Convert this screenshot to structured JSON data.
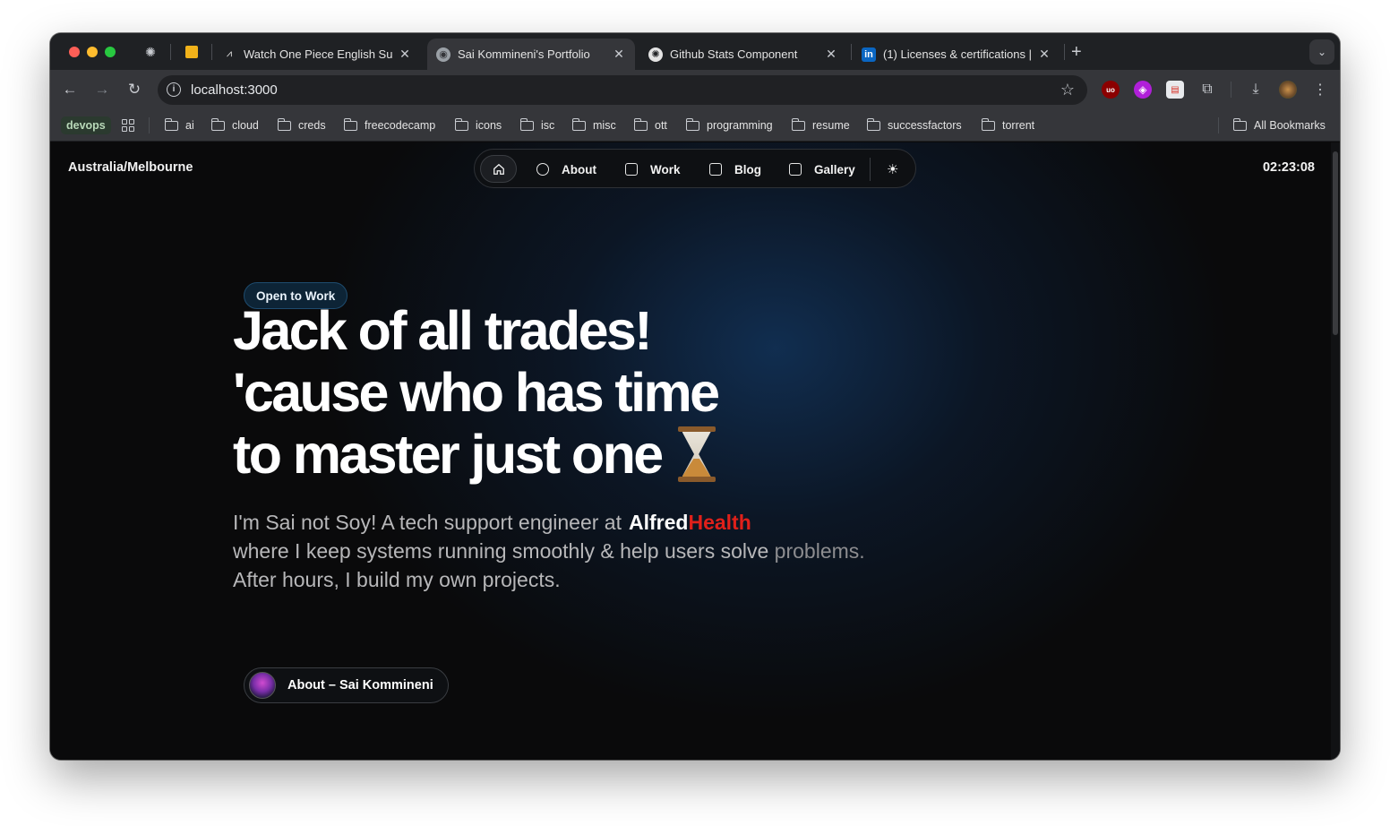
{
  "browser": {
    "tabs": [
      {
        "title": "Watch One Piece English Sub",
        "favicon": "anime-site-icon",
        "active": false
      },
      {
        "title": "Sai Kommineni's Portfolio",
        "favicon": "globe-icon",
        "active": true
      },
      {
        "title": "Github Stats Component",
        "favicon": "openai-icon",
        "active": false
      },
      {
        "title": "(1) Licenses & certifications |",
        "favicon": "linkedin-icon",
        "active": false
      }
    ],
    "url": "localhost:3000",
    "linkedin_glyph": "in",
    "ublock_glyph": "uo",
    "bookmarks": {
      "devops_label": "devops",
      "folders": [
        "ai",
        "cloud",
        "creds",
        "freecodecamp",
        "icons",
        "isc",
        "misc",
        "ott",
        "programming",
        "resume",
        "successfactors",
        "torrent"
      ],
      "all_label": "All Bookmarks"
    }
  },
  "site": {
    "timezone": "Australia/Melbourne",
    "clock": "02:23:08",
    "nav": {
      "about": "About",
      "work": "Work",
      "blog": "Blog",
      "gallery": "Gallery"
    },
    "badge": "Open to Work",
    "headline": [
      "Jack of all trades!",
      "'cause who has time",
      "to master just one"
    ],
    "intro": {
      "line1": "I'm Sai not Soy! A tech support engineer at",
      "brand_a": "Alfred",
      "brand_b": "Health",
      "line2_a": "where I keep systems running smoothly & help users solve ",
      "line2_b": "problems.",
      "line3": "After hours, I build my own projects."
    },
    "cta": "About – Sai Kommineni"
  },
  "colors": {
    "accent_red": "#e0201a",
    "badge_bg": "#0d2436",
    "page_bg": "#0a0a0b"
  }
}
